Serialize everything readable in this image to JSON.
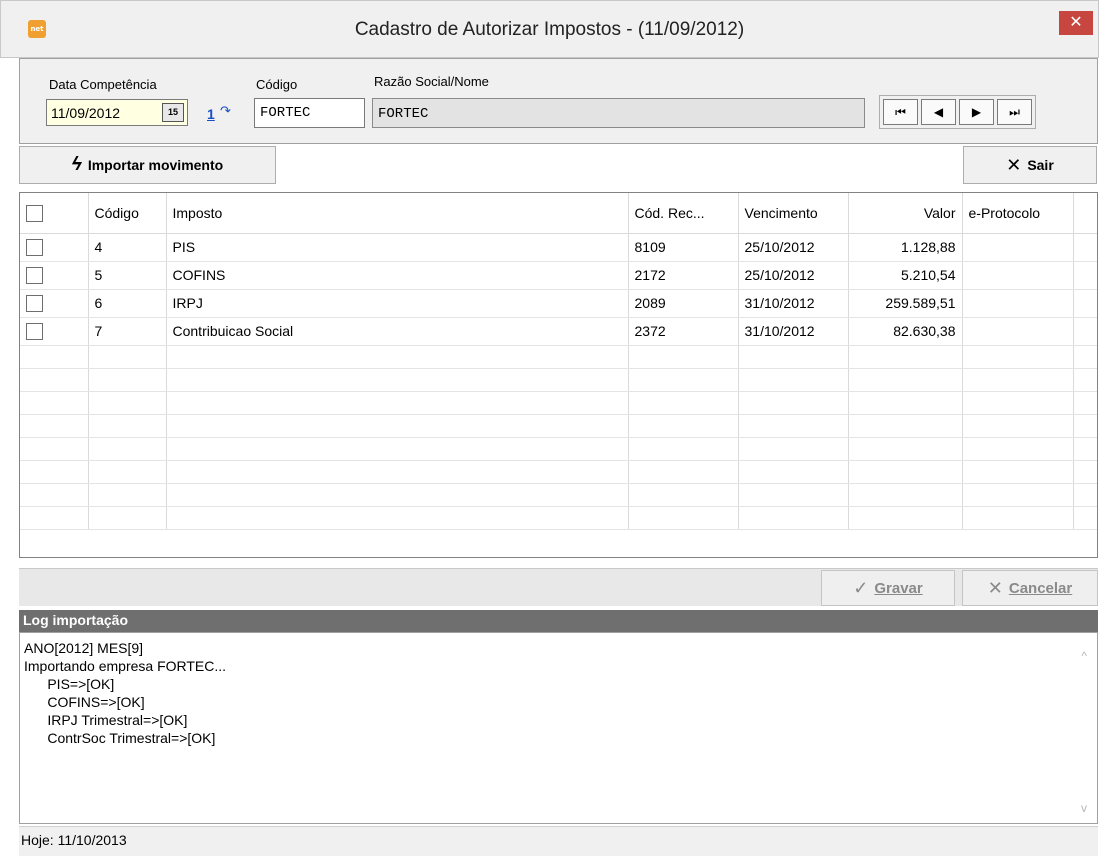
{
  "window": {
    "title": "Cadastro de Autorizar Impostos - (11/09/2012)",
    "app_icon": "net",
    "close_label": "✕"
  },
  "header": {
    "date_label": "Data Competência",
    "date_value": "11/09/2012",
    "calendar_icon": "15",
    "code_label": "Código",
    "code_link": "1",
    "code_value": "FORTEC",
    "razao_label": "Razão Social/Nome",
    "razao_value": "FORTEC",
    "nav": [
      "⏮",
      "◀",
      "▶",
      "⏭"
    ]
  },
  "toolbar": {
    "import_label": "Importar movimento",
    "exit_label": "Sair"
  },
  "grid": {
    "columns": [
      "",
      "Código",
      "Imposto",
      "Cód. Rec...",
      "Vencimento",
      "Valor",
      "e-Protocolo"
    ],
    "rows": [
      {
        "codigo": "4",
        "imposto": "PIS",
        "cod_rec": "8109",
        "vencimento": "25/10/2012",
        "valor": "1.128,88",
        "protocolo": ""
      },
      {
        "codigo": "5",
        "imposto": "COFINS",
        "cod_rec": "2172",
        "vencimento": "25/10/2012",
        "valor": "5.210,54",
        "protocolo": ""
      },
      {
        "codigo": "6",
        "imposto": "IRPJ",
        "cod_rec": "2089",
        "vencimento": "31/10/2012",
        "valor": "259.589,51",
        "protocolo": ""
      },
      {
        "codigo": "7",
        "imposto": "Contribuicao Social",
        "cod_rec": "2372",
        "vencimento": "31/10/2012",
        "valor": "82.630,38",
        "protocolo": ""
      }
    ]
  },
  "actions": {
    "save_label": "Gravar",
    "cancel_label": "Cancelar"
  },
  "log": {
    "title": "Log importação",
    "lines": [
      "ANO[2012] MES[9]",
      "Importando empresa FORTEC...",
      "      PIS=>[OK]",
      "      COFINS=>[OK]",
      "      IRPJ Trimestral=>[OK]",
      "      ContrSoc Trimestral=>[OK]"
    ]
  },
  "status": {
    "today": "Hoje: 11/10/2013"
  }
}
